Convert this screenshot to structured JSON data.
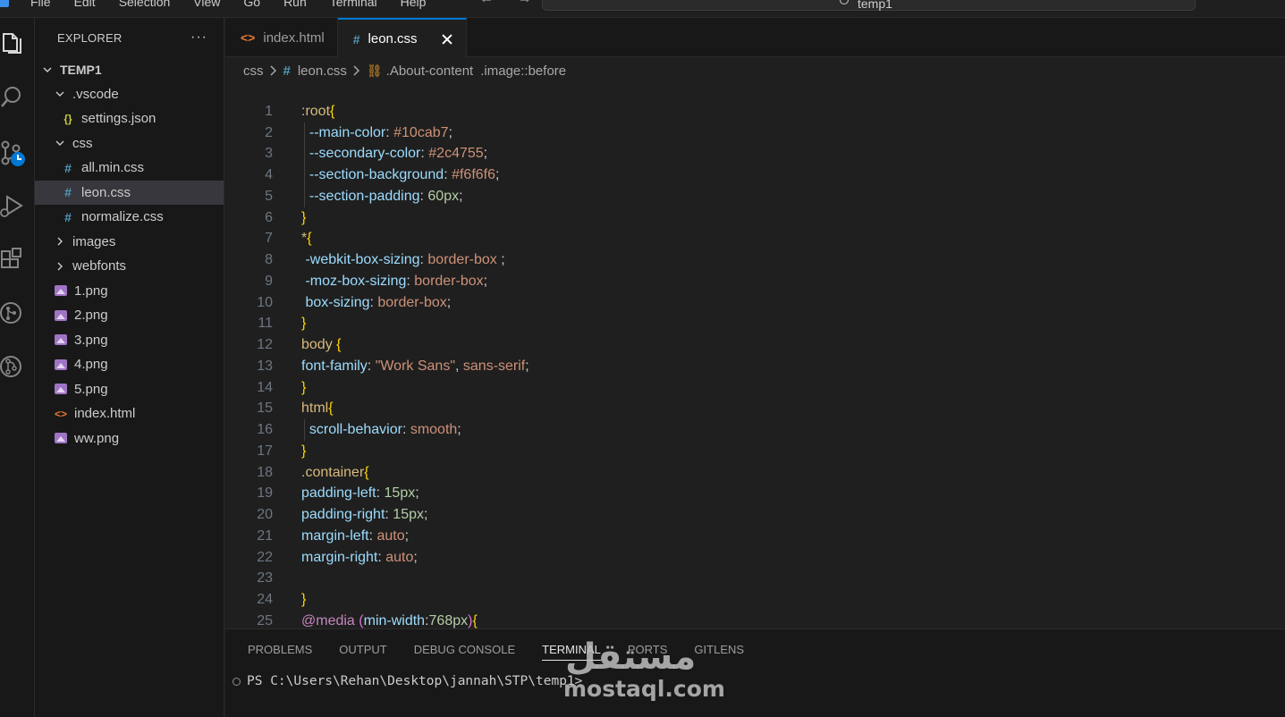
{
  "menu": [
    "File",
    "Edit",
    "Selection",
    "View",
    "Go",
    "Run",
    "Terminal",
    "Help"
  ],
  "nav": {
    "back": "←",
    "forward": "→"
  },
  "command_center": {
    "text": "temp1"
  },
  "activity_icons": [
    "explorer-icon",
    "search-icon",
    "source-control-icon",
    "run-debug-icon",
    "extensions-icon",
    "git-graph-icon",
    "gitlens-icon"
  ],
  "sidebar": {
    "title": "EXPLORER",
    "more": "···",
    "tree": [
      {
        "label": "TEMP1",
        "kind": "root",
        "level": 0,
        "expanded": true
      },
      {
        "label": ".vscode",
        "kind": "folder",
        "level": 1,
        "expanded": true
      },
      {
        "label": "settings.json",
        "kind": "json",
        "level": 2
      },
      {
        "label": "css",
        "kind": "folder",
        "level": 1,
        "expanded": true
      },
      {
        "label": "all.min.css",
        "kind": "css",
        "level": 2
      },
      {
        "label": "leon.css",
        "kind": "css",
        "level": 2,
        "selected": true
      },
      {
        "label": "normalize.css",
        "kind": "css",
        "level": 2
      },
      {
        "label": "images",
        "kind": "folder",
        "level": 1,
        "expanded": false
      },
      {
        "label": "webfonts",
        "kind": "folder",
        "level": 1,
        "expanded": false
      },
      {
        "label": "1.png",
        "kind": "image",
        "level": 1
      },
      {
        "label": "2.png",
        "kind": "image",
        "level": 1
      },
      {
        "label": "3.png",
        "kind": "image",
        "level": 1
      },
      {
        "label": "4.png",
        "kind": "image",
        "level": 1
      },
      {
        "label": "5.png",
        "kind": "image",
        "level": 1
      },
      {
        "label": "index.html",
        "kind": "html",
        "level": 1
      },
      {
        "label": "ww.png",
        "kind": "image",
        "level": 1
      }
    ]
  },
  "tabs": [
    {
      "label": "index.html",
      "icon": "html",
      "active": false
    },
    {
      "label": "leon.css",
      "icon": "css",
      "active": true
    }
  ],
  "breadcrumb": {
    "folder": "css",
    "file": "leon.css",
    "selector": ".About-content",
    "pseudo": ".image::before"
  },
  "code_lines": [
    [
      [
        "t-sel",
        ":root"
      ],
      [
        "t-brace",
        "{"
      ]
    ],
    [
      [
        "t-punc",
        "  "
      ],
      [
        "t-prop",
        "--main-color"
      ],
      [
        "t-punc",
        ": "
      ],
      [
        "t-val",
        "#10cab7"
      ],
      [
        "t-punc",
        ";"
      ]
    ],
    [
      [
        "t-punc",
        "  "
      ],
      [
        "t-prop",
        "--secondary-color"
      ],
      [
        "t-punc",
        ": "
      ],
      [
        "t-val",
        "#2c4755"
      ],
      [
        "t-punc",
        ";"
      ]
    ],
    [
      [
        "t-punc",
        "  "
      ],
      [
        "t-prop",
        "--section-background"
      ],
      [
        "t-punc",
        ": "
      ],
      [
        "t-val",
        "#f6f6f6"
      ],
      [
        "t-punc",
        ";"
      ]
    ],
    [
      [
        "t-punc",
        "  "
      ],
      [
        "t-prop",
        "--section-padding"
      ],
      [
        "t-punc",
        ": "
      ],
      [
        "t-num",
        "60px"
      ],
      [
        "t-punc",
        ";"
      ]
    ],
    [
      [
        "t-brace",
        "}"
      ]
    ],
    [
      [
        "t-sel",
        "*"
      ],
      [
        "t-brace",
        "{"
      ]
    ],
    [
      [
        "t-punc",
        " "
      ],
      [
        "t-prop",
        "-webkit-box-sizing"
      ],
      [
        "t-punc",
        ": "
      ],
      [
        "t-val",
        "border-box"
      ],
      [
        "t-punc",
        " ;"
      ]
    ],
    [
      [
        "t-punc",
        " "
      ],
      [
        "t-prop",
        "-moz-box-sizing"
      ],
      [
        "t-punc",
        ": "
      ],
      [
        "t-val",
        "border-box"
      ],
      [
        "t-punc",
        ";"
      ]
    ],
    [
      [
        "t-punc",
        " "
      ],
      [
        "t-prop",
        "box-sizing"
      ],
      [
        "t-punc",
        ": "
      ],
      [
        "t-val",
        "border-box"
      ],
      [
        "t-punc",
        ";"
      ]
    ],
    [
      [
        "t-brace",
        "}"
      ]
    ],
    [
      [
        "t-sel",
        "body "
      ],
      [
        "t-brace",
        "{"
      ]
    ],
    [
      [
        "t-prop",
        "font-family"
      ],
      [
        "t-punc",
        ": "
      ],
      [
        "t-val",
        "\"Work Sans\""
      ],
      [
        "t-punc",
        ", "
      ],
      [
        "t-val",
        "sans-serif"
      ],
      [
        "t-punc",
        ";"
      ]
    ],
    [
      [
        "t-brace",
        "}"
      ]
    ],
    [
      [
        "t-sel",
        "html"
      ],
      [
        "t-brace",
        "{"
      ]
    ],
    [
      [
        "t-punc",
        "  "
      ],
      [
        "t-prop",
        "scroll-behavior"
      ],
      [
        "t-punc",
        ": "
      ],
      [
        "t-val",
        "smooth"
      ],
      [
        "t-punc",
        ";"
      ]
    ],
    [
      [
        "t-brace",
        "}"
      ]
    ],
    [
      [
        "t-sel",
        ".container"
      ],
      [
        "t-brace",
        "{"
      ]
    ],
    [
      [
        "t-prop",
        "padding-left"
      ],
      [
        "t-punc",
        ": "
      ],
      [
        "t-num",
        "15px"
      ],
      [
        "t-punc",
        ";"
      ]
    ],
    [
      [
        "t-prop",
        "padding-right"
      ],
      [
        "t-punc",
        ": "
      ],
      [
        "t-num",
        "15px"
      ],
      [
        "t-punc",
        ";"
      ]
    ],
    [
      [
        "t-prop",
        "margin-left"
      ],
      [
        "t-punc",
        ": "
      ],
      [
        "t-val",
        "auto"
      ],
      [
        "t-punc",
        ";"
      ]
    ],
    [
      [
        "t-prop",
        "margin-right"
      ],
      [
        "t-punc",
        ": "
      ],
      [
        "t-val",
        "auto"
      ],
      [
        "t-punc",
        ";"
      ]
    ],
    [],
    [
      [
        "t-brace",
        "}"
      ]
    ],
    [
      [
        "t-at",
        "@media"
      ],
      [
        "t-punc",
        " "
      ],
      [
        "t-brace2",
        "("
      ],
      [
        "t-prop",
        "min-width"
      ],
      [
        "t-punc",
        ":"
      ],
      [
        "t-num",
        "768px"
      ],
      [
        "t-brace2",
        ")"
      ],
      [
        "t-brace",
        "{"
      ]
    ]
  ],
  "panel": {
    "tabs": [
      "PROBLEMS",
      "OUTPUT",
      "DEBUG CONSOLE",
      "TERMINAL",
      "PORTS",
      "GITLENS"
    ],
    "active_tab": "TERMINAL",
    "terminal_prompt": "PS C:\\Users\\Rehan\\Desktop\\jannah\\STP\\temp1>"
  },
  "watermark": {
    "arabic": "مستقل",
    "latin": "mostaql.com"
  }
}
